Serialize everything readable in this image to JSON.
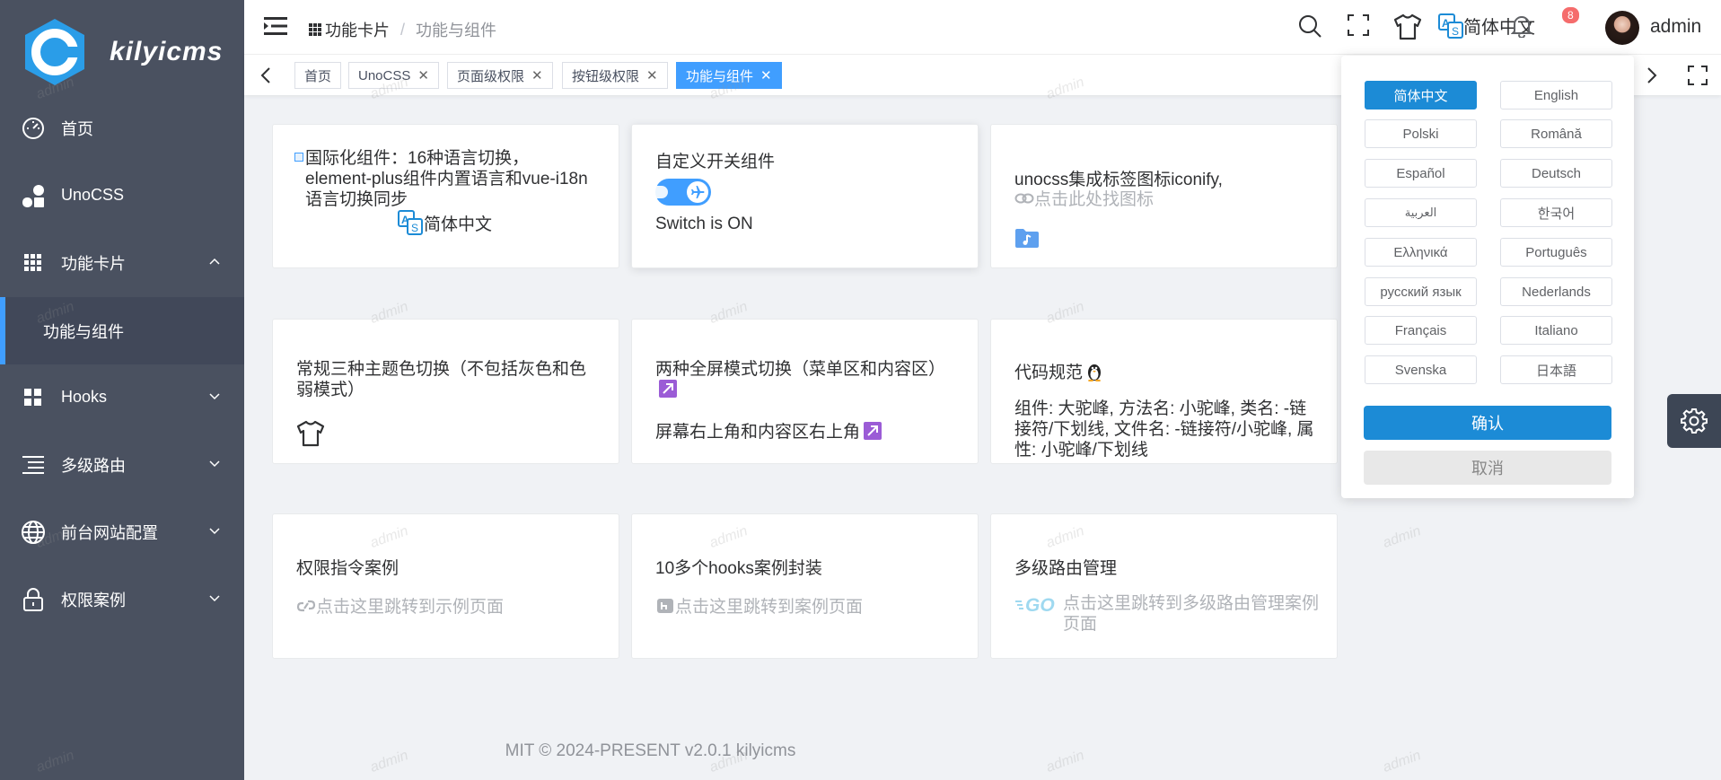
{
  "app": {
    "name": "kilyicms",
    "logo_letter": "C"
  },
  "sidebar": {
    "items": [
      {
        "label": "首页",
        "icon": "dashboard-icon"
      },
      {
        "label": "UnoCSS",
        "icon": "unocss-icon"
      },
      {
        "label": "功能卡片",
        "icon": "grid-icon",
        "expanded": true
      },
      {
        "label": "Hooks",
        "icon": "apps-icon"
      },
      {
        "label": "多级路由",
        "icon": "list-icon"
      },
      {
        "label": "前台网站配置",
        "icon": "globe-icon"
      },
      {
        "label": "权限案例",
        "icon": "lock-icon"
      }
    ],
    "sub_active": "功能与组件"
  },
  "header": {
    "breadcrumb": [
      "功能卡片",
      "功能与组件"
    ],
    "language": "简体中文",
    "notification_count": "8",
    "username": "admin"
  },
  "tags": [
    {
      "label": "首页",
      "closable": false,
      "active": false
    },
    {
      "label": "UnoCSS",
      "closable": true,
      "active": false
    },
    {
      "label": "页面级权限",
      "closable": true,
      "active": false
    },
    {
      "label": "按钮级权限",
      "closable": true,
      "active": false
    },
    {
      "label": "功能与组件",
      "closable": true,
      "active": true
    }
  ],
  "cards": {
    "i18n": {
      "title": "国际化组件：16种语言切换，element-plus组件内置语言和vue-i18n语言切换同步",
      "lang_label": "简体中文"
    },
    "switch": {
      "title": "自定义开关组件",
      "status": "Switch is ON"
    },
    "icons": {
      "title": "unocss集成标签图标iconify,",
      "link": "点击此处找图标"
    },
    "theme": {
      "title": "常规三种主题色切换（不包括灰色和色弱模式）"
    },
    "fullscreen": {
      "title": "两种全屏模式切换（菜单区和内容区）",
      "desc": "屏幕右上角和内容区右上角"
    },
    "code": {
      "title": "代码规范",
      "desc": "组件: 大驼峰, 方法名: 小驼峰, 类名: -链接符/下划线, 文件名: -链接符/小驼峰, 属性: 小驼峰/下划线"
    },
    "permission": {
      "title": "权限指令案例",
      "link": "点击这里跳转到示例页面"
    },
    "hooks": {
      "title": "10多个hooks案例封装",
      "link": "点击这里跳转到案例页面"
    },
    "routes": {
      "title": "多级路由管理",
      "link": "点击这里跳转到多级路由管理案例页面"
    }
  },
  "language_popup": {
    "languages": [
      "简体中文",
      "English",
      "Polski",
      "Română",
      "Español",
      "Deutsch",
      "العربية",
      "한국어",
      "Ελληνικά",
      "Português",
      "русский язык",
      "Nederlands",
      "Français",
      "Italiano",
      "Svenska",
      "日本語"
    ],
    "selected": "简体中文",
    "confirm": "确认",
    "cancel": "取消"
  },
  "footer": "MIT © 2024-PRESENT v2.0.1 kilyicms",
  "watermark": "admin",
  "colors": {
    "sidebar": "#4a5160",
    "primary": "#409eff",
    "confirm": "#1c8bd6"
  }
}
